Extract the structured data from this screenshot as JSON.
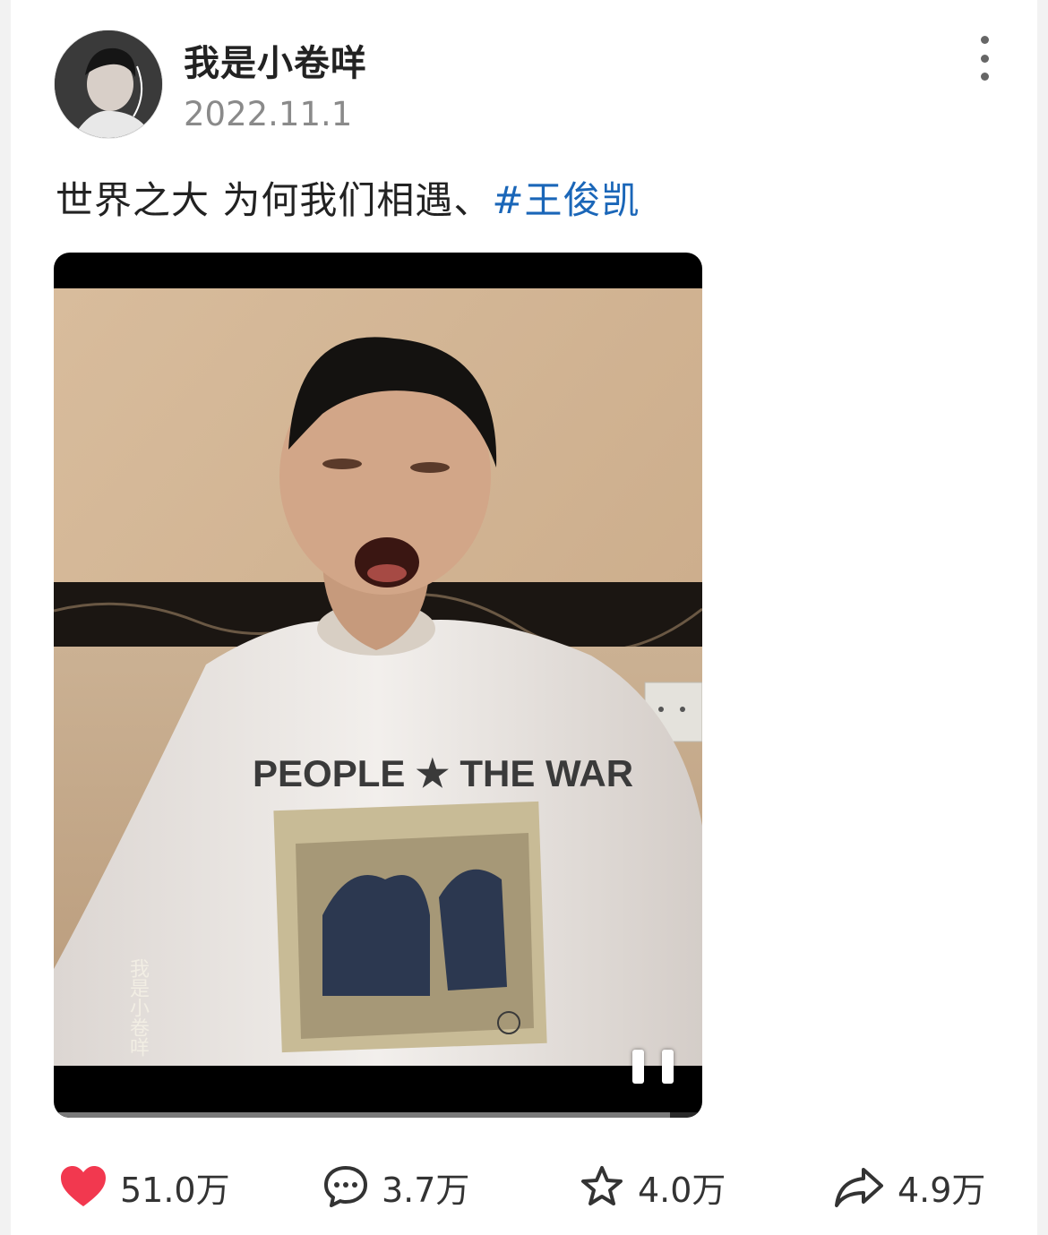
{
  "post": {
    "username": "我是小卷咩",
    "date": "2022.11.1",
    "caption_text": "世界之大 为何我们相遇、",
    "hashtag": "#王俊凯"
  },
  "video": {
    "watermark_text": "我是小卷咩",
    "shirt_text": "PEOPLE ★ THE WAR",
    "state": "playing",
    "progress": 0.95
  },
  "actions": {
    "like": {
      "icon": "heart-icon",
      "count": "51.0万",
      "color": "#f2384f"
    },
    "comment": {
      "icon": "comment-icon",
      "count": "3.7万"
    },
    "favorite": {
      "icon": "star-icon",
      "count": "4.0万"
    },
    "share": {
      "icon": "share-arrow-icon",
      "count": "4.9万"
    }
  },
  "colors": {
    "hashtag": "#1a66b8",
    "username": "#222222",
    "date": "#8a8a8a"
  }
}
